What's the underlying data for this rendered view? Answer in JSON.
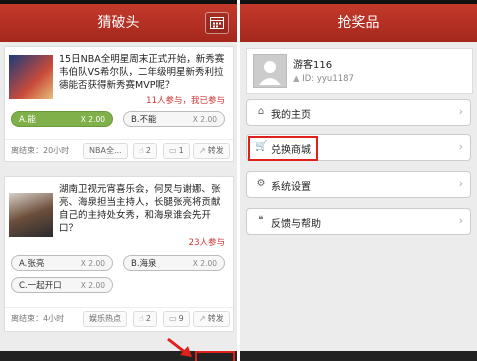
{
  "left": {
    "title": "猜破头",
    "cards": [
      {
        "question": "15日NBA全明星周末正式开始，新秀赛韦伯队VS希尔队，二年级明星新秀利拉德能否获得新秀赛MVP呢？",
        "participants": "11人参与，我已参与",
        "options": [
          {
            "name": "A.能",
            "odds": "X 2.00",
            "selected": true
          },
          {
            "name": "B.不能",
            "odds": "X 2.00",
            "selected": false
          }
        ],
        "end": "离结束：20小时",
        "category": "NBA全...",
        "likes": "2",
        "comments": "1",
        "share": "转发"
      },
      {
        "question": "湖南卫视元宵喜乐会，何炅与谢娜、张亮、海泉担当主持人，长腿张亮将贡献自己的主持处女秀，和海泉谁会先开口？",
        "participants": "23人参与",
        "options": [
          {
            "name": "A.张亮",
            "odds": "X 2.00",
            "selected": false
          },
          {
            "name": "B.海泉",
            "odds": "X 2.00",
            "selected": false
          },
          {
            "name": "C.一起开口",
            "odds": "X 2.00",
            "selected": false
          }
        ],
        "end": "离结束：4小时",
        "category": "娱乐热点",
        "likes": "2",
        "comments": "9",
        "share": "转发"
      }
    ]
  },
  "right": {
    "title": "抢奖品",
    "user": {
      "name": "游客116",
      "id": "ID: yyu1187"
    },
    "menu": [
      {
        "icon": "home-icon",
        "label": "我的主页"
      },
      {
        "icon": "cart-icon",
        "label": "兑换商城"
      },
      {
        "icon": "gear-icon",
        "label": "系统设置"
      },
      {
        "icon": "quote-icon",
        "label": "反馈与帮助"
      }
    ]
  },
  "colors": {
    "header": "#b02d20",
    "highlight": "#e0201a",
    "selected_option": "#7fb04a"
  }
}
